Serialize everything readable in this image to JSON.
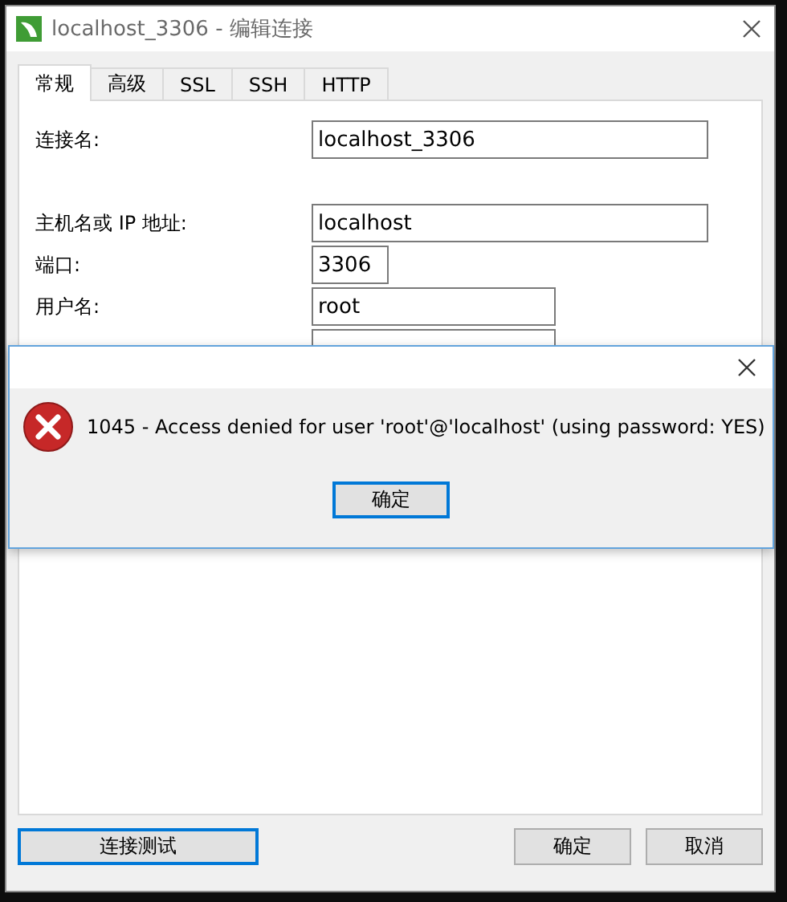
{
  "window": {
    "title": "localhost_3306 - 编辑连接"
  },
  "tabs": [
    {
      "label": "常规",
      "selected": true
    },
    {
      "label": "高级",
      "selected": false
    },
    {
      "label": "SSL",
      "selected": false
    },
    {
      "label": "SSH",
      "selected": false
    },
    {
      "label": "HTTP",
      "selected": false
    }
  ],
  "fields": [
    {
      "kind": "wide",
      "label": "连接名:",
      "value": "localhost_3306"
    },
    {
      "kind": "wide",
      "label": "主机名或 IP 地址:",
      "value": "localhost"
    },
    {
      "kind": "short",
      "label": "端口:",
      "value": "3306"
    },
    {
      "kind": "medium",
      "label": "用户名:",
      "value": "root"
    },
    {
      "kind": "covered"
    }
  ],
  "buttons": [
    {
      "label": "连接测试",
      "focused": true
    },
    {
      "label": "确定",
      "focused": false
    },
    {
      "label": "取消",
      "focused": false
    }
  ],
  "error_dialog": {
    "message": "1045 - Access denied for user 'root'@'localhost' (using password: YES)",
    "button": "确定"
  }
}
